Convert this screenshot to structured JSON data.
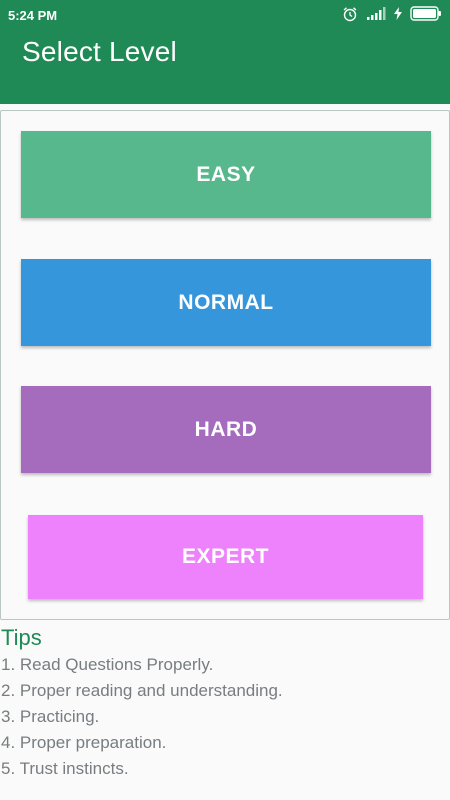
{
  "status_bar": {
    "time": "5:24 PM",
    "icons": [
      "alarm-icon",
      "signal-icon",
      "charging-icon",
      "battery-icon"
    ]
  },
  "app_bar": {
    "title": "Select Level"
  },
  "levels": [
    {
      "label": "EASY",
      "color": "#56b88c"
    },
    {
      "label": "NORMAL",
      "color": "#3596dc"
    },
    {
      "label": "HARD",
      "color": "#a56bbd"
    },
    {
      "label": "EXPERT",
      "color": "#ee82fc"
    }
  ],
  "tips": {
    "title": "Tips",
    "items": [
      "1. Read Questions Properly.",
      "2. Proper reading and understanding.",
      "3. Practicing.",
      "4. Proper preparation.",
      "5. Trust instincts."
    ]
  },
  "colors": {
    "primary": "#1f8a55",
    "tip_text": "#777d80"
  }
}
